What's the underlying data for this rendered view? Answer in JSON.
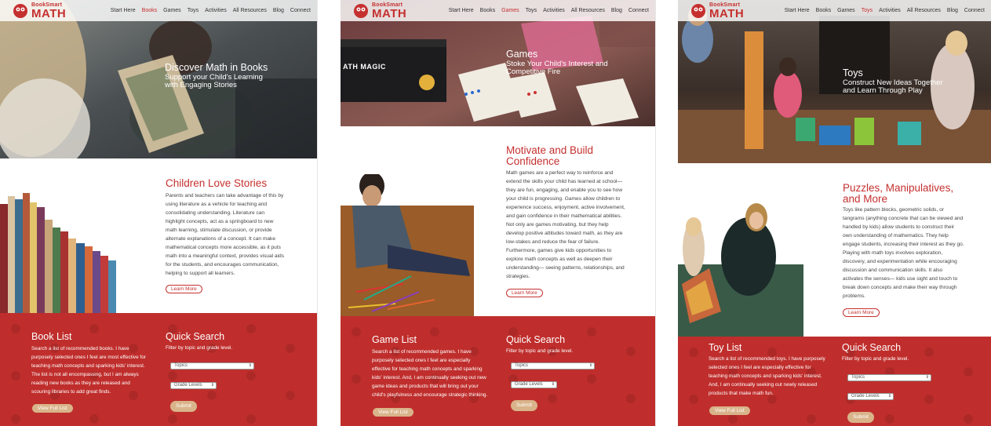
{
  "brand": {
    "small": "BookSmart",
    "big": "MATH"
  },
  "menu": [
    "Start Here",
    "Books",
    "Games",
    "Toys",
    "Activities",
    "All Resources",
    "Blog",
    "Connect"
  ],
  "colors": {
    "brand_red": "#bf2e2c",
    "accent_tan": "#d9b48a"
  },
  "panels": [
    {
      "active_menu": "Books",
      "hero": {
        "title": "Discover Math in Books",
        "sub1": "Support your Child's Learning",
        "sub2": "with Engaging Stories"
      },
      "mid": {
        "title1": "Children Love Stories",
        "title2": "",
        "body": [
          "Parents and teachers can take advantage of this by",
          "using literature as a vehicle for teaching and",
          "consolidating understanding. Literature can",
          "highlight concepts, act as a springboard to new",
          "math learning, stimulate discussion, or provide",
          "alternate explanations of a concept. It can make",
          "mathematical concepts more accessible, as it puts",
          "math into a meaningful context, provides visual aids",
          "for the students, and encourages communication,",
          "helping to support all learners."
        ],
        "learn_more": "Learn More"
      },
      "list": {
        "title": "Book List",
        "body": [
          "Search a list of recommended books. I have",
          "purposely selected ones I feel are most effective for",
          "teaching math concepts and sparking kids' interest.",
          "The list is not all encompassing, but I am always",
          "reading new books as they are released and",
          "scouring libraries to add great finds."
        ],
        "button": "View Full List"
      },
      "search": {
        "title": "Quick Search",
        "sub": "Filter by topic and grade level.",
        "topics": "Topics",
        "grades": "Grade Levels",
        "submit": "Submit"
      }
    },
    {
      "active_menu": "Games",
      "hero": {
        "title": "Games",
        "sub1": "Stoke Your Child's Interest and",
        "sub2": "Competitive Fire",
        "box_text": "ATH MAGIC"
      },
      "mid": {
        "title1": "Motivate and Build",
        "title2": "Confidence",
        "body": [
          "Math games are a perfect way to reinforce and",
          "extend the skills your child has learned at school—",
          "they are fun, engaging, and enable you to see how",
          "your child is progressing. Games allow children to",
          "experience success, enjoyment, active involvement,",
          "and gain confidence in their mathematical abilities.",
          "Not only are games motivating, but they help",
          "develop positive attitudes toward math, as they are",
          "low-stakes and reduce the fear of failure.",
          "Furthermore, games give kids opportunities to",
          "explore math concepts as well as deepen their",
          "understanding— seeing patterns, relationships, and",
          "strategies."
        ],
        "learn_more": "Learn More"
      },
      "list": {
        "title": "Game List",
        "body": [
          "Search a list of recommended games. I have",
          "purposely selected ones I feel are especially",
          "effective for teaching math concepts and sparking",
          "kids' interest. And, I am continually seeking out new",
          "game ideas and products that will bring out your",
          "child's playfulness and encourage strategic thinking."
        ],
        "button": "View Full List"
      },
      "search": {
        "title": "Quick Search",
        "sub": "Filter by topic and grade level.",
        "topics": "Topics",
        "grades": "Grade Levels",
        "submit": "Submit"
      }
    },
    {
      "active_menu": "Toys",
      "hero": {
        "title": "Toys",
        "sub1": "Construct New Ideas Together",
        "sub2": "and Learn Through Play"
      },
      "mid": {
        "title1": "Puzzles, Manipulatives,",
        "title2": "and More",
        "body": [
          "Toys like pattern blocks, geometric solids, or",
          "tangrams (anything concrete that can be viewed and",
          "handled by kids) allow students to construct their",
          "own understanding of mathematics. They help",
          "engage students, increasing their interest as they go.",
          "Playing with math toys involves exploration,",
          "discovery, and experimentation while encouraging",
          "discussion and communication skills. It also",
          "activates the senses— kids use sight and touch to",
          "break down concepts and make their way through",
          "problems."
        ],
        "learn_more": "Learn More"
      },
      "list": {
        "title": "Toy List",
        "body": [
          "Search a list of recommended toys. I have purposely",
          "selected ones I feel are especially effective for",
          "teaching math concepts and sparking kids' interest.",
          "And, I am continually seeking out newly released",
          "products that make math fun."
        ],
        "button": "View Full List"
      },
      "search": {
        "title": "Quick Search",
        "sub": "Filter by topic and grade level.",
        "topics": "Topics",
        "grades": "Grade Levels",
        "submit": "Submit"
      }
    }
  ]
}
